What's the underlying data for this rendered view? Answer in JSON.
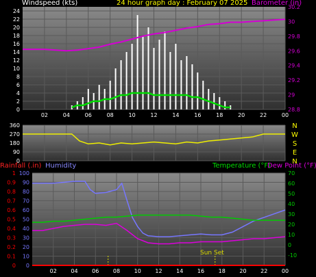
{
  "header": {
    "windspeed_label": "Windspeed (kts)",
    "graph_day": "24 hour graph day : February 07 2025",
    "barometer_label": "Barometer (in)"
  },
  "colors": {
    "wind": "#ffffff",
    "wind_avg": "#00dd00",
    "barometer": "#d400d4",
    "direction": "#eeee00",
    "humidity": "#7777ff",
    "temperature": "#00cc00",
    "dewpoint": "#dd00dd",
    "rainfall": "#ff0000",
    "sunrise_sunset": "#dddd00"
  },
  "lower_legend": {
    "rainfall_label": "Rainfall (.in)",
    "humidity_label": "Humidity",
    "temperature_label": "Temperature (°F)",
    "dewpoint_label": "Dew Point (°F)",
    "sunset_label": "Sun Set"
  },
  "chart_data": [
    {
      "id": "wind",
      "type": "bar",
      "title": "24 hour graph day : February 07 2025",
      "ylabel": "Windspeed (kts)",
      "ylabel_right": "Barometer (in)",
      "x_ticks": [
        "02",
        "04",
        "06",
        "08",
        "10",
        "12",
        "14",
        "16",
        "18",
        "20",
        "22",
        "00"
      ],
      "x_range": [
        0,
        24
      ],
      "y_ticks": [
        "0",
        "2",
        "4",
        "6",
        "8",
        "10",
        "12",
        "14",
        "16",
        "18",
        "20",
        "22",
        "24"
      ],
      "y_range": [
        0,
        25
      ],
      "y_right_ticks": [
        "28.8",
        "29",
        "29.2",
        "29.4",
        "29.6",
        "29.8",
        "30",
        "30.2"
      ],
      "y_right_range": [
        28.8,
        30.2
      ],
      "series": [
        {
          "key": "gust",
          "x": [
            4.5,
            5.0,
            5.5,
            6.0,
            6.5,
            7.0,
            7.5,
            8.0,
            8.5,
            9.0,
            9.5,
            10.0,
            10.5,
            11.0,
            11.5,
            12.0,
            12.5,
            13.0,
            13.5,
            14.0,
            14.5,
            15.0,
            15.5,
            16.0,
            16.5,
            17.0,
            17.5,
            18.0,
            18.5,
            19.0
          ],
          "values": [
            1,
            2,
            3,
            5,
            4,
            6,
            5,
            7,
            10,
            12,
            14,
            16,
            23,
            18,
            20,
            15,
            17,
            19,
            14,
            16,
            12,
            13,
            11,
            9,
            7,
            5,
            4,
            3,
            2,
            1
          ]
        },
        {
          "key": "average",
          "x": [
            4.5,
            5.0,
            5.5,
            6.0,
            6.5,
            7.0,
            7.5,
            8.0,
            8.5,
            9.0,
            9.5,
            10.0,
            10.5,
            11.0,
            11.5,
            12.0,
            12.5,
            13.0,
            13.5,
            14.0,
            14.5,
            15.0,
            15.5,
            16.0,
            16.5,
            17.0,
            17.5,
            18.0,
            18.5,
            19.0
          ],
          "values": [
            0.5,
            1,
            1,
            1.5,
            2,
            2,
            2.5,
            2.5,
            3,
            3.5,
            3.5,
            4,
            4,
            4,
            4,
            3.5,
            3.5,
            3.5,
            3.5,
            3.5,
            3.5,
            3.5,
            3,
            3,
            2.5,
            2,
            1.5,
            1,
            0.5,
            0.5
          ]
        },
        {
          "key": "barometer",
          "axis": "right",
          "x": [
            0,
            2,
            4,
            5,
            6,
            7,
            8,
            9,
            10,
            11,
            12,
            13,
            14,
            15,
            16,
            17,
            18,
            19,
            20,
            21,
            22,
            23,
            24
          ],
          "values": [
            29.62,
            29.62,
            29.6,
            29.61,
            29.63,
            29.65,
            29.69,
            29.72,
            29.76,
            29.8,
            29.83,
            29.85,
            29.88,
            29.91,
            29.93,
            29.96,
            29.97,
            29.99,
            29.99,
            30.0,
            30.01,
            30.02,
            30.03
          ]
        }
      ]
    },
    {
      "id": "direction",
      "type": "line",
      "x_range": [
        0,
        24
      ],
      "y_ticks": [
        "360",
        "270",
        "180",
        "90",
        "0"
      ],
      "y_range": [
        0,
        360
      ],
      "right_labels": [
        "N",
        "W",
        "S",
        "E",
        "N"
      ],
      "series": [
        {
          "key": "direction",
          "x": [
            0,
            4.5,
            5.2,
            6.0,
            7.0,
            8.0,
            9.0,
            10.0,
            11.0,
            12.0,
            13.0,
            14.0,
            15.0,
            16.0,
            17.0,
            18.0,
            19.0,
            20.0,
            21.0,
            22.0,
            24.0
          ],
          "values": [
            270,
            270,
            200,
            170,
            180,
            160,
            180,
            170,
            180,
            190,
            180,
            170,
            190,
            180,
            200,
            210,
            220,
            230,
            240,
            270,
            270
          ]
        }
      ]
    },
    {
      "id": "lower",
      "type": "line",
      "x_ticks": [
        "02",
        "04",
        "06",
        "08",
        "10",
        "12",
        "14",
        "16",
        "18",
        "20",
        "22",
        "00"
      ],
      "x_range": [
        0,
        24
      ],
      "y_left_outer_ticks": [
        "0",
        "0.1",
        "0.2",
        "0.3",
        "0.4",
        "0.5",
        "0.6",
        "0.7",
        "0.8",
        "0.9",
        "1"
      ],
      "y_left_outer_range": [
        0,
        1
      ],
      "y_left_inner_ticks": [
        "0",
        "10",
        "20",
        "30",
        "40",
        "50",
        "60",
        "70",
        "80",
        "90",
        "100"
      ],
      "y_left_inner_range": [
        0,
        100
      ],
      "y_right_ticks": [
        "-10",
        "0",
        "10",
        "20",
        "30",
        "40",
        "50",
        "60",
        "70"
      ],
      "y_right_range": [
        -20,
        70
      ],
      "series": [
        {
          "key": "humidity",
          "axis": "left_inner",
          "x": [
            0,
            1,
            2,
            3,
            4,
            5,
            5.5,
            6,
            7,
            8,
            8.5,
            9,
            9.5,
            10,
            10.5,
            11,
            12,
            13,
            14,
            15,
            16,
            17,
            18,
            19,
            20,
            21,
            22,
            23,
            24
          ],
          "values": [
            89,
            89,
            89,
            90,
            91,
            91,
            82,
            78,
            79,
            82,
            89,
            70,
            52,
            42,
            35,
            32,
            31,
            31,
            32,
            33,
            34,
            33,
            33,
            36,
            42,
            48,
            52,
            56,
            60
          ]
        },
        {
          "key": "temperature",
          "axis": "right",
          "x": [
            0,
            1,
            2,
            3,
            4,
            5,
            6,
            7,
            8,
            9,
            10,
            11,
            12,
            13,
            14,
            15,
            16,
            17,
            18,
            19,
            20,
            21,
            22,
            23,
            24
          ],
          "values": [
            22,
            22,
            23,
            23,
            24,
            25,
            26,
            27,
            27,
            28,
            29,
            29,
            29,
            29,
            29,
            29,
            28,
            27,
            27,
            26,
            25,
            24,
            24,
            24,
            24
          ]
        },
        {
          "key": "dewpoint",
          "axis": "right",
          "x": [
            0,
            1,
            2,
            3,
            4,
            5,
            6,
            7,
            8,
            9,
            10,
            11,
            12,
            13,
            14,
            15,
            16,
            17,
            18,
            19,
            20,
            21,
            22,
            23,
            24
          ],
          "values": [
            14,
            14,
            16,
            18,
            19,
            20,
            20,
            19,
            21,
            14,
            6,
            2,
            1,
            1,
            2,
            2,
            3,
            3,
            3,
            4,
            5,
            6,
            6,
            7,
            8
          ]
        },
        {
          "key": "rainfall",
          "axis": "left_outer",
          "x": [
            0,
            24
          ],
          "values": [
            0,
            0
          ]
        }
      ],
      "markers": [
        {
          "key": "sunrise",
          "x": 7.2
        },
        {
          "key": "sunset",
          "x": 17.35
        }
      ]
    }
  ]
}
